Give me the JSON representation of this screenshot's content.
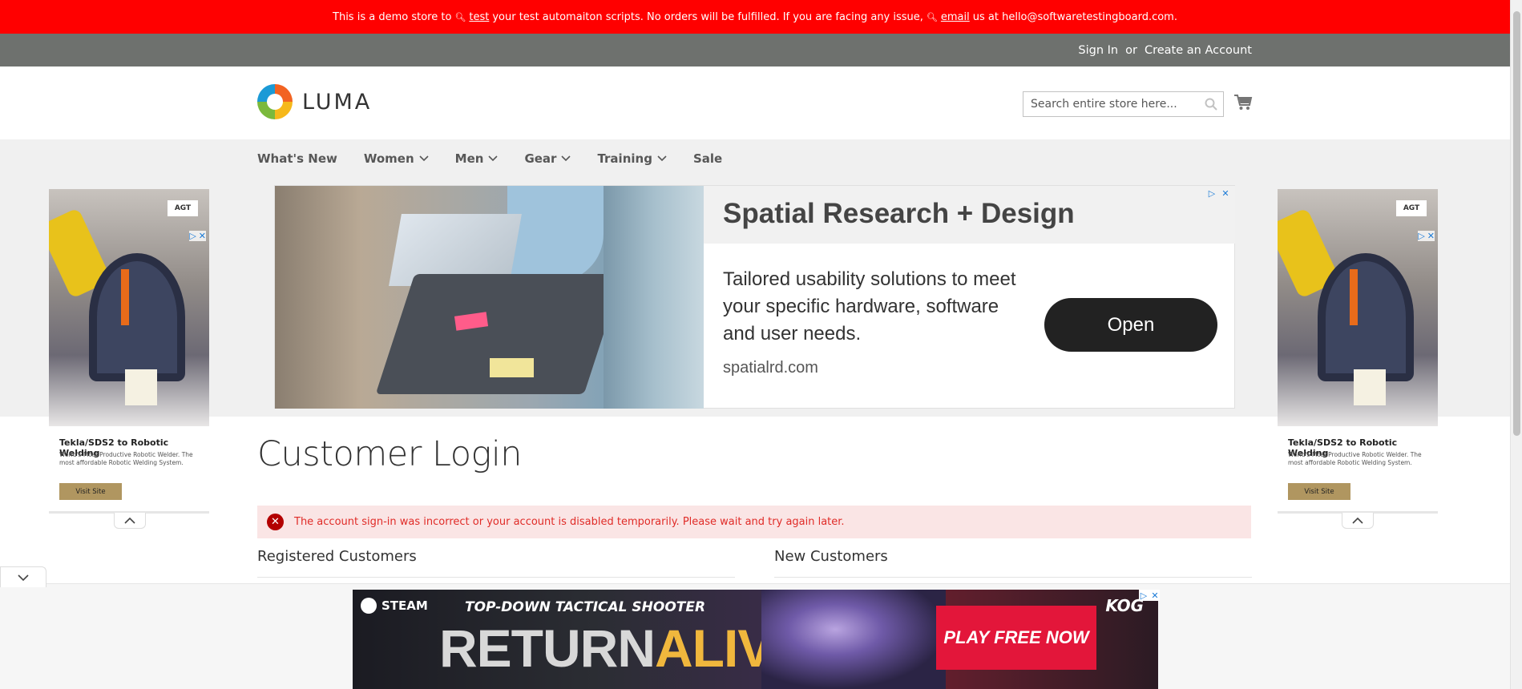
{
  "demo_banner": {
    "part1": "This is a demo store to",
    "link1": "test",
    "part2": "your test automaiton scripts. No orders will be fulfilled. If you are facing any issue,",
    "link2": "email",
    "part3": "us at hello@softwaretestingboard.com."
  },
  "header": {
    "sign_in": "Sign In",
    "or": "or",
    "create_account": "Create an Account"
  },
  "logo": {
    "text": "LUMA"
  },
  "search": {
    "placeholder": "Search entire store here..."
  },
  "nav": {
    "items": [
      {
        "label": "What's New"
      },
      {
        "label": "Women"
      },
      {
        "label": "Men"
      },
      {
        "label": "Gear"
      },
      {
        "label": "Training"
      },
      {
        "label": "Sale"
      }
    ]
  },
  "ad_main": {
    "title": "Spatial Research + Design",
    "body": "Tailored usability solutions to meet your specific hardware, software and user needs.",
    "domain": "spatialrd.com",
    "cta": "Open"
  },
  "side_ad": {
    "logo": "AGT",
    "title": "Tekla/SDS2 to Robotic Welding",
    "desc": "World's Most Productive Robotic Welder. The most affordable Robotic Welding System.",
    "cta": "Visit Site"
  },
  "main": {
    "page_title": "Customer Login",
    "error": "The account sign-in was incorrect or your account is disabled temporarily. Please wait and try again later.",
    "registered_title": "Registered Customers",
    "new_title": "New Customers"
  },
  "bottom_ad": {
    "brand": "STEAM",
    "tagline": "TOP-DOWN TACTICAL SHOOTER",
    "headline_a": "RETURN",
    "headline_b": "ALIVE",
    "cta": "PLAY FREE NOW",
    "publisher": "KOG"
  }
}
